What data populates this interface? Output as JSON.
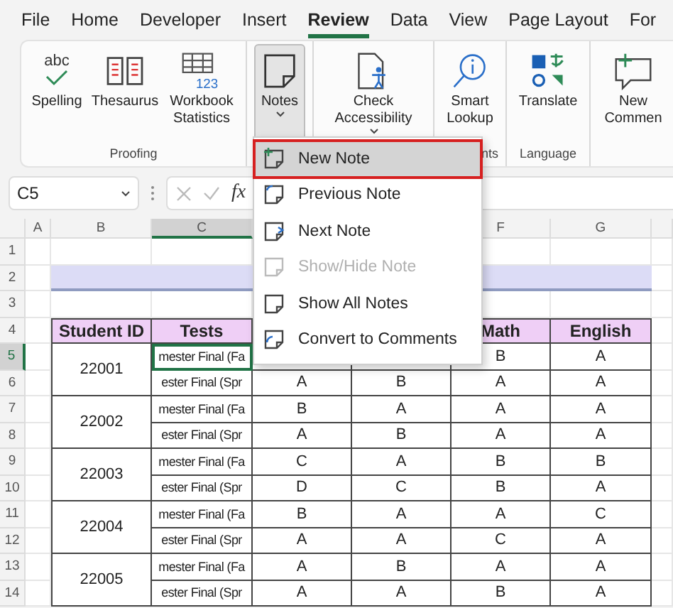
{
  "ribbon_tabs": [
    {
      "label": "File",
      "selected": false
    },
    {
      "label": "Home",
      "selected": false
    },
    {
      "label": "Developer",
      "selected": false
    },
    {
      "label": "Insert",
      "selected": false
    },
    {
      "label": "Review",
      "selected": true
    },
    {
      "label": "Data",
      "selected": false
    },
    {
      "label": "View",
      "selected": false
    },
    {
      "label": "Page Layout",
      "selected": false
    },
    {
      "label": "For",
      "selected": false
    }
  ],
  "ribbon_groups": [
    {
      "label": "Proofing",
      "buttons": [
        {
          "label": "Spelling",
          "icon_text": "abc"
        },
        {
          "label": "Thesaurus"
        },
        {
          "label": "Workbook Statistics",
          "icon_text": "123"
        }
      ]
    },
    {
      "buttons": [
        {
          "label": "Notes",
          "pressed": true,
          "dropdown": true
        }
      ]
    },
    {
      "buttons": [
        {
          "label": "Check Accessibility",
          "dropdown": true
        }
      ]
    },
    {
      "label": "nts",
      "label_cut_left": true,
      "buttons": [
        {
          "label": "Smart Lookup"
        }
      ]
    },
    {
      "label": "Language",
      "buttons": [
        {
          "label": "Translate"
        }
      ]
    },
    {
      "buttons": [
        {
          "label": "New Commen"
        }
      ]
    }
  ],
  "formula_bar": {
    "name_box": "C5",
    "function_label": "fx"
  },
  "sheet": {
    "columns_left": [
      {
        "label": "A",
        "selected": false
      },
      {
        "label": "B",
        "selected": false
      },
      {
        "label": "C",
        "selected": true
      }
    ],
    "columns_right": [
      {
        "label": "F",
        "selected": false
      },
      {
        "label": "G",
        "selected": false
      }
    ],
    "rows": [
      {
        "label": "1",
        "selected": false
      },
      {
        "label": "2",
        "selected": false
      },
      {
        "label": "3",
        "selected": false
      },
      {
        "label": "4",
        "selected": false
      },
      {
        "label": "5",
        "selected": true
      },
      {
        "label": "6",
        "selected": false
      },
      {
        "label": "7",
        "selected": false
      },
      {
        "label": "8",
        "selected": false
      },
      {
        "label": "9",
        "selected": false
      },
      {
        "label": "10",
        "selected": false
      },
      {
        "label": "11",
        "selected": false
      },
      {
        "label": "12",
        "selected": false
      },
      {
        "label": "13",
        "selected": false
      },
      {
        "label": "14",
        "selected": false
      }
    ],
    "table": {
      "headers_left": [
        "Student ID",
        "Tests"
      ],
      "headers_right": [
        "Math",
        "English"
      ],
      "students": [
        {
          "id": "22001",
          "tests": [
            {
              "test": "mester Final (Fa",
              "grades": [
                "B",
                "A"
              ]
            },
            {
              "test": "ester Final (Spr",
              "grades": [
                "A",
                "B",
                "A",
                "A"
              ]
            }
          ]
        },
        {
          "id": "22002",
          "tests": [
            {
              "test": "mester Final (Fa",
              "grades": [
                "B",
                "A",
                "A",
                "A"
              ]
            },
            {
              "test": "ester Final (Spr",
              "grades": [
                "A",
                "B",
                "A",
                "A"
              ]
            }
          ]
        },
        {
          "id": "22003",
          "tests": [
            {
              "test": "mester Final (Fa",
              "grades": [
                "C",
                "A",
                "B",
                "B"
              ]
            },
            {
              "test": "ester Final (Spr",
              "grades": [
                "D",
                "C",
                "B",
                "A"
              ]
            }
          ]
        },
        {
          "id": "22004",
          "tests": [
            {
              "test": "mester Final (Fa",
              "grades": [
                "B",
                "A",
                "A",
                "C"
              ]
            },
            {
              "test": "ester Final (Spr",
              "grades": [
                "A",
                "A",
                "C",
                "A"
              ]
            }
          ]
        },
        {
          "id": "22005",
          "tests": [
            {
              "test": "mester Final (Fa",
              "grades": [
                "A",
                "B",
                "A",
                "A"
              ]
            },
            {
              "test": "ester Final (Spr",
              "grades": [
                "A",
                "A",
                "B",
                "A"
              ]
            }
          ]
        }
      ]
    }
  },
  "notes_menu": [
    {
      "label": "New Note",
      "selected": true,
      "disabled": false
    },
    {
      "label": "Previous Note",
      "selected": false,
      "disabled": false
    },
    {
      "label": "Next Note",
      "selected": false,
      "disabled": false
    },
    {
      "label": "Show/Hide Note",
      "selected": false,
      "disabled": true
    },
    {
      "label": "Show All Notes",
      "selected": false,
      "disabled": false
    },
    {
      "label": "Convert to Comments",
      "selected": false,
      "disabled": false
    }
  ]
}
